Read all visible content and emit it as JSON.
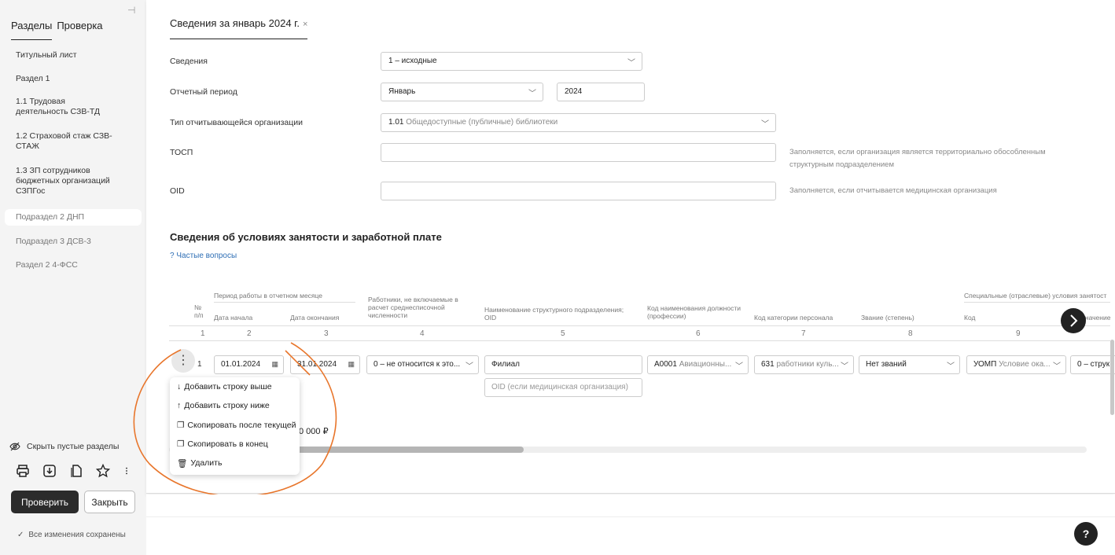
{
  "sidebar": {
    "tabs": [
      "Разделы",
      "Проверка"
    ],
    "items": [
      "Титульный лист",
      "Раздел 1",
      "1.1 Трудовая деятельность СЗВ-ТД",
      "1.2 Страховой стаж СЗВ-СТАЖ",
      "1.3 ЗП сотрудников бюджетных организаций СЗПГос",
      "Подраздел 2 ДНП",
      "Подраздел 3 ДСВ-3",
      "Раздел 2 4-ФСС"
    ],
    "hide_empty": "Скрыть пустые разделы",
    "check_button": "Проверить",
    "close_button": "Закрыть",
    "saved_status": "Все изменения сохранены"
  },
  "tab": {
    "title": "Сведения за январь 2024 г.",
    "close": "×"
  },
  "form": {
    "svedeniya_label": "Сведения",
    "svedeniya_value": "1 – исходные",
    "period_label": "Отчетный период",
    "period_month": "Январь",
    "period_year": "2024",
    "org_type_label": "Тип отчитывающейся организации",
    "org_type_code": "1.01",
    "org_type_value": "Общедоступные (публичные) библиотеки",
    "tosp_label": "ТОСП",
    "tosp_value": "",
    "tosp_hint": "Заполняется, если организация является территориально обособленным структурным подразделением",
    "oid_label": "OID",
    "oid_value": "",
    "oid_hint": "Заполняется, если отчитывается медицинская организация"
  },
  "section": {
    "title": "Сведения об условиях занятости и заработной плате",
    "faq": "Частые вопросы"
  },
  "table": {
    "headers": {
      "num": "№ п/п",
      "period_group": "Период работы в отчетном месяце",
      "date_start": "Дата начала",
      "date_end": "Дата окончания",
      "excluded": "Работники, не включаемые в расчет среднесписочной численности",
      "dept": "Наименование структурного подразделения; OID",
      "position": "Код наименования должности (профессии)",
      "category": "Код категории персонала",
      "rank": "Звание (степень)",
      "special_group": "Специальные (отраслевые) условия занятост",
      "code": "Код",
      "meaning": "значение"
    },
    "col_numbers": [
      "1",
      "2",
      "3",
      "4",
      "5",
      "6",
      "7",
      "8",
      "9"
    ],
    "row": {
      "num": "1",
      "date_start": "01.01.2024",
      "date_end": "31.01.2024",
      "excluded": "0 – не относится к это...",
      "dept": "Филиал",
      "dept_oid_placeholder": "OID (если медицинская организация)",
      "position_code": "А0001",
      "position_text": "Авиационны...",
      "category_code": "631",
      "category_text": "работники куль...",
      "rank": "Нет званий",
      "special_code": "УОМП",
      "special_text": "Условие ока...",
      "special_value": "0 – струк"
    },
    "sum": "0 000 ₽"
  },
  "context_menu": {
    "items": [
      {
        "icon": "↓",
        "label": "Добавить строку выше"
      },
      {
        "icon": "↑",
        "label": "Добавить строку ниже"
      },
      {
        "icon": "❐",
        "label": "Скопировать после текущей"
      },
      {
        "icon": "❐",
        "label": "Скопировать в конец"
      },
      {
        "icon": "🗑",
        "label": "Удалить"
      }
    ]
  },
  "help": "?",
  "colors": {
    "accent": "#2f6fb5",
    "dark": "#222222",
    "annotation": "#e8762c"
  }
}
